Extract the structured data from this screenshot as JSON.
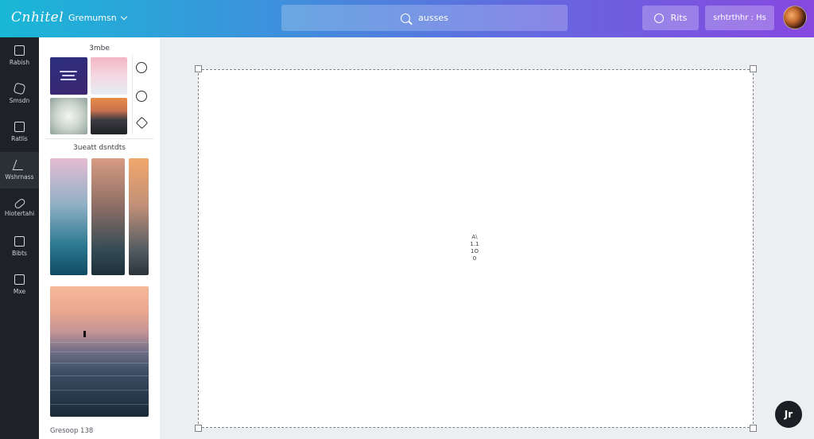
{
  "app": {
    "logo": "Cnhitel",
    "menu_label": "Gremumsn"
  },
  "search": {
    "text": "ausses"
  },
  "header_buttons": {
    "button_a": "Rits",
    "button_b": "srhtrthhr : Hs"
  },
  "rail": {
    "items": [
      {
        "label": "Rabish"
      },
      {
        "label": "Smsdn"
      },
      {
        "label": "Ratlis"
      },
      {
        "label": "Wshrnass"
      },
      {
        "label": "Hiotertahi"
      },
      {
        "label": "Bibts"
      },
      {
        "label": "Mxe"
      }
    ]
  },
  "panel": {
    "section1_title": "3mbe",
    "section2_title": "3ueatt dsntdts",
    "footer": "Gresoop 138"
  },
  "canvas": {
    "center_text": [
      "A\\",
      "1.1",
      "1O",
      "0"
    ]
  },
  "fab": {
    "label": "Jr"
  }
}
